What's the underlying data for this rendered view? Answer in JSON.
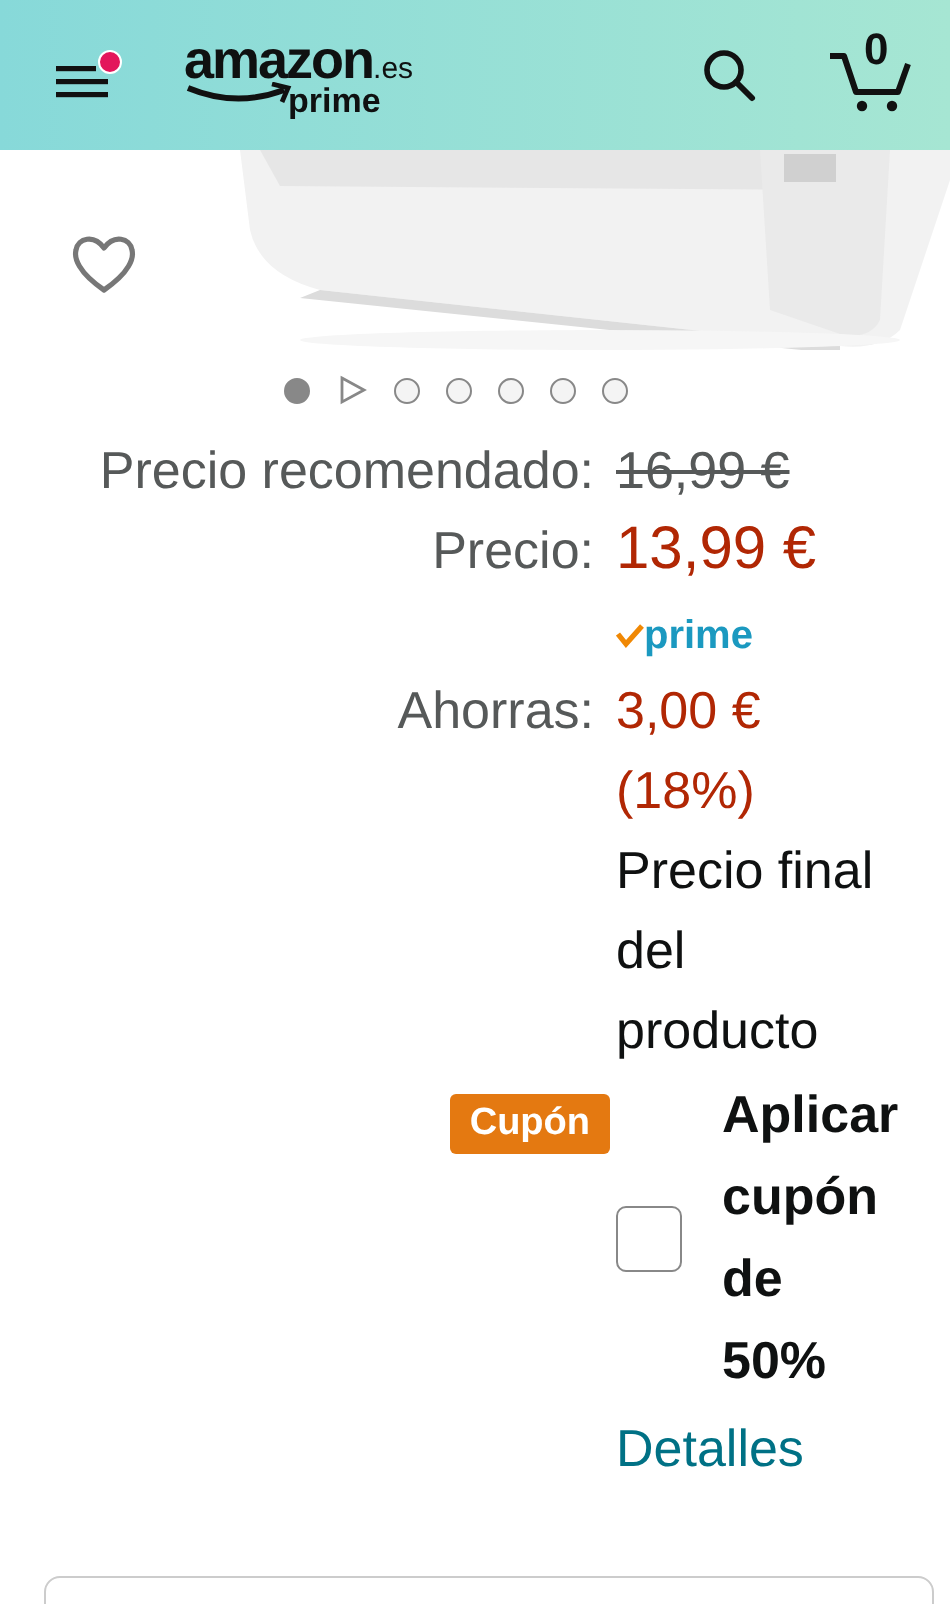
{
  "header": {
    "logo": "amazon",
    "logo_suffix": ".es",
    "logo_sub": "prime",
    "menu_notification": true,
    "cart_count": "0"
  },
  "carousel": [
    {
      "kind": "dot",
      "selected": true
    },
    {
      "kind": "video",
      "selected": false
    },
    {
      "kind": "dot",
      "selected": false
    },
    {
      "kind": "dot",
      "selected": false
    },
    {
      "kind": "dot",
      "selected": false
    },
    {
      "kind": "dot",
      "selected": false
    },
    {
      "kind": "dot",
      "selected": false
    }
  ],
  "prices": [
    {
      "kind": "list",
      "label": "Precio recomendado:",
      "value": "16,99 €"
    },
    {
      "kind": "price",
      "label": "Precio:",
      "value": "13,99 €",
      "badge": "prime"
    },
    {
      "kind": "saving",
      "label": "Ahorras:",
      "value": "3,00 € (18%)",
      "note": "Precio final del producto"
    }
  ],
  "coupon": {
    "badge": "Cupón",
    "checked": false,
    "label": "Aplicar cupón de 50%",
    "link": "Detalles"
  }
}
